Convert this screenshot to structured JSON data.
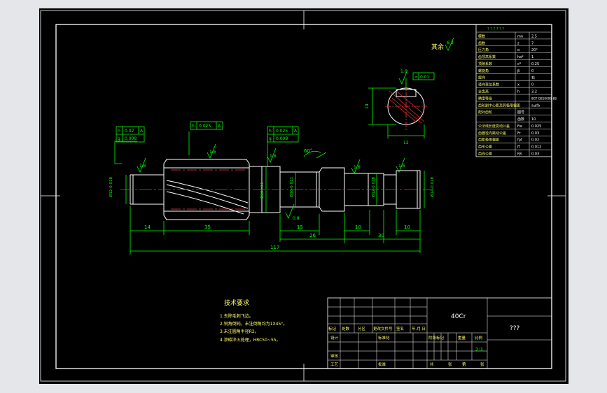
{
  "drawing": {
    "material": "40Cr",
    "drawing_name": "???",
    "scale": "2:1",
    "roughness_note_label": "其余",
    "roughness_note_value": "6.3"
  },
  "tech_requirements": {
    "title": "技术要求",
    "items": [
      "1.去除毛刺飞边。",
      "2.锐角倒钝，未注倒角均为1X45°。",
      "3.未注圆角半径R2。",
      "4.渗碳淬火处理，HRC50~55。"
    ]
  },
  "dimensions": {
    "d1": "14",
    "d2": "35",
    "d3": "15",
    "d4": "10",
    "d5": "10",
    "d6": "26",
    "d7": "30",
    "total": "117",
    "angle": "60°",
    "dia_left": "Ø12-0.018",
    "dia_gear": "Ø30 h11",
    "dia_mid": "Ø16-0.011",
    "dia_bearing": "Ø12-0.018",
    "dia_right": "Ø14-0.018",
    "section_width": "12",
    "section_height": "14",
    "roughness_values": [
      "1.6",
      "1.6",
      "1.6",
      "1.6",
      "1.6",
      "1.6",
      "0.8"
    ]
  },
  "tolerance_frames": [
    {
      "rows": [
        [
          "h",
          "0.02",
          "A"
        ],
        [
          "g",
          "0.008",
          ""
        ]
      ]
    },
    {
      "rows": [
        [
          "h",
          "0.025",
          "A"
        ]
      ]
    },
    {
      "rows": [
        [
          "h",
          "0.025",
          "A"
        ],
        [
          "g",
          "0.008",
          ""
        ]
      ]
    }
  ],
  "section": {
    "tol_sym": "=",
    "tol_val": "0.01"
  },
  "gear_params": {
    "header": "? ? ? ? ? ?",
    "rows": [
      [
        "模数",
        "mn",
        "2.5"
      ],
      [
        "齿数",
        "z",
        "7"
      ],
      [
        "压力角",
        "α",
        "20°"
      ],
      [
        "齿顶高系数",
        "ha*",
        "1"
      ],
      [
        "顶隙系数",
        "c*",
        "0.25"
      ],
      [
        "螺旋角",
        "β",
        "0"
      ],
      [
        "旋向",
        "",
        "右"
      ],
      [
        "径向变位系数",
        "x",
        "0"
      ],
      [
        "全齿高",
        "h",
        "3.2"
      ],
      [
        "精度等级",
        "",
        "8GT GB10095-88"
      ],
      [
        "齿轮副中心距及其极限偏差",
        "",
        "a±fa"
      ],
      [
        "配对齿轮",
        "图号",
        ""
      ],
      [
        "",
        "齿数",
        "10"
      ],
      [
        "公法线长度变动公差",
        "Fw",
        "0.025"
      ],
      [
        "齿圈径向跳动公差",
        "Fr",
        "0.03"
      ],
      [
        "齿距极限偏差",
        "fpt",
        "0.02"
      ],
      [
        "齿形公差",
        "ff",
        "0.012"
      ],
      [
        "齿向公差",
        "Fβ",
        "0.03"
      ]
    ]
  },
  "title_block": {
    "labels": {
      "mark": "标记",
      "count": "处数",
      "zone": "分区",
      "change_doc": "更改文件号",
      "sign": "签名",
      "date": "年.月.日",
      "designer": "设计",
      "standardize": "标准化",
      "stage_mark": "阶段标记",
      "weight": "重量",
      "ratio": "比例",
      "review": "审核",
      "process": "工艺",
      "approve": "批准",
      "sheets_total": "共",
      "sheets_word": "张",
      "sheet_no": "第",
      "sheet_word": "张"
    }
  }
}
